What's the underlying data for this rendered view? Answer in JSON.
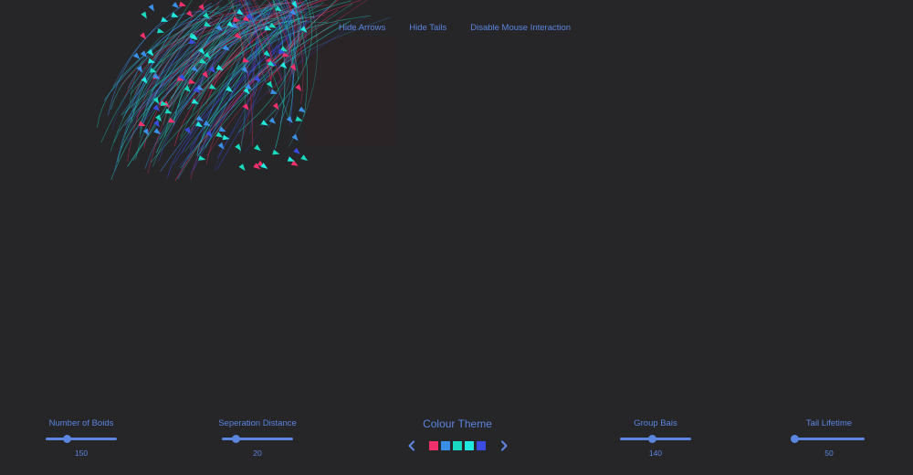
{
  "top_controls": {
    "hide_arrows": "Hide Arrows",
    "hide_tails": "Hide Tails",
    "disable_mouse": "Disable Mouse Interaction"
  },
  "sliders": {
    "num_boids": {
      "label": "Number of Boids",
      "value": "150",
      "fraction": 0.3
    },
    "separation": {
      "label": "Seperation Distance",
      "value": "20",
      "fraction": 0.2
    },
    "group_bias": {
      "label": "Group Bais",
      "value": "140",
      "fraction": 0.45
    },
    "tail_lifetime": {
      "label": "Tail Lifetime",
      "value": "50",
      "fraction": 0.02
    }
  },
  "colour_theme": {
    "title": "Colour Theme",
    "swatches": [
      "#f0306a",
      "#3a8fe8",
      "#18d8c0",
      "#20e8e0",
      "#3a4ce0"
    ]
  },
  "colors": {
    "accent": "#5b86e0",
    "background": "#262527"
  }
}
